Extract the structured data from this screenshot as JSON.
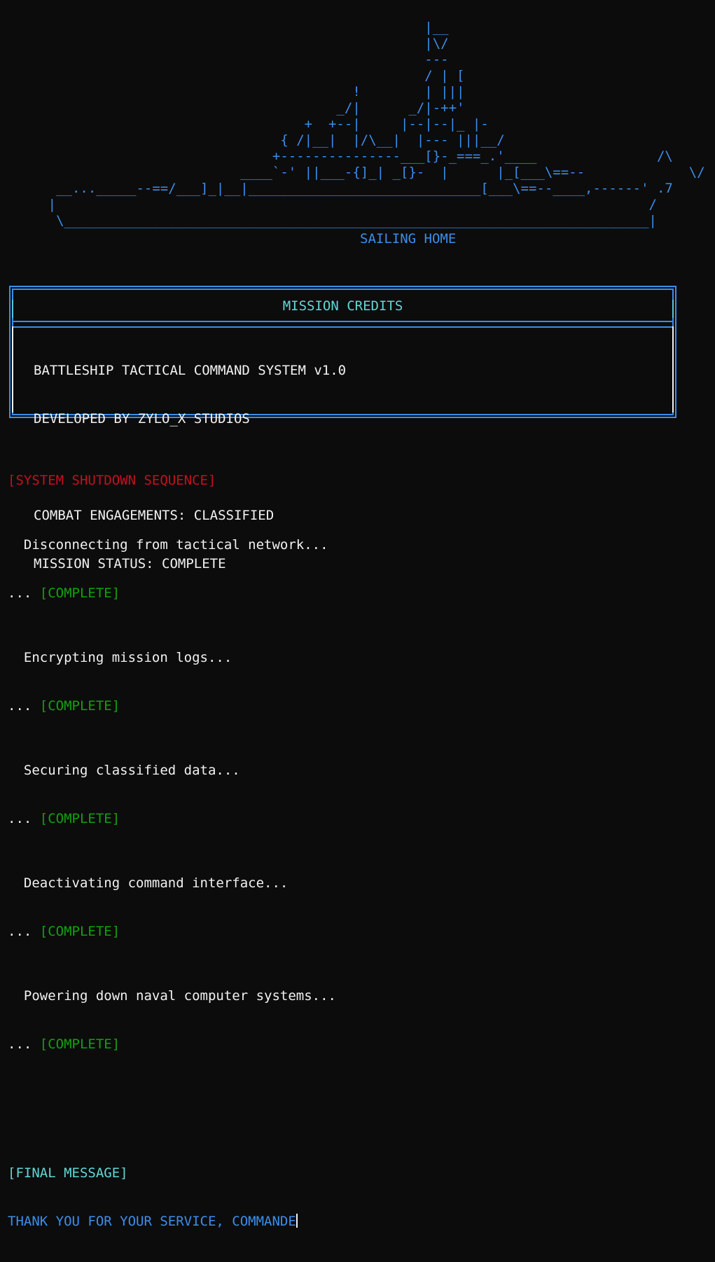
{
  "ship_art": [
    "                                                     |__",
    "                                                     |\\/",
    "                                                     ---",
    "                                                     / | [",
    "                                            !        | |||",
    "                                          _/|      _/|-++'",
    "                                      +  +--|     |--|--|_ |-",
    "                                   { /|__|  |/\\__|  |--- |||__/",
    "                                  +---------------___[}-_===_.'____               /\\",
    "                              ____`-' ||___-{]_| _[}-  |      |_[___\\==--             \\/   _",
    "       __..._____--==/___]_|__|_____________________________[___\\==--____,------' .7",
    "      |                                                                          /",
    "       \\_________________________________________________________________________|"
  ],
  "ship_caption": "SAILING HOME",
  "credits": {
    "title": "MISSION CREDITS",
    "lines": [
      "BATTLESHIP TACTICAL COMMAND SYSTEM v1.0",
      "DEVELOPED BY ZYLO_X STUDIOS",
      "",
      "COMBAT ENGAGEMENTS: CLASSIFIED",
      "MISSION STATUS: COMPLETE"
    ]
  },
  "shutdown": {
    "header": "[SYSTEM SHUTDOWN SEQUENCE]",
    "prefix": "... ",
    "steps": [
      {
        "text": "  Disconnecting from tactical network...",
        "status": "[COMPLETE]"
      },
      {
        "text": "  Encrypting mission logs...",
        "status": "[COMPLETE]"
      },
      {
        "text": "  Securing classified data...",
        "status": "[COMPLETE]"
      },
      {
        "text": "  Deactivating command interface...",
        "status": "[COMPLETE]"
      },
      {
        "text": "  Powering down naval computer systems...",
        "status": "[COMPLETE]"
      }
    ]
  },
  "final": {
    "header": "[FINAL MESSAGE]",
    "message": "THANK YOU FOR YOUR SERVICE, COMMANDE"
  },
  "colors": {
    "background": "#0c0c0c",
    "blue": "#3b8eea",
    "cyan": "#61d6d6",
    "red": "#c50f1f",
    "green": "#13a10e",
    "white": "#f2f2f2"
  }
}
